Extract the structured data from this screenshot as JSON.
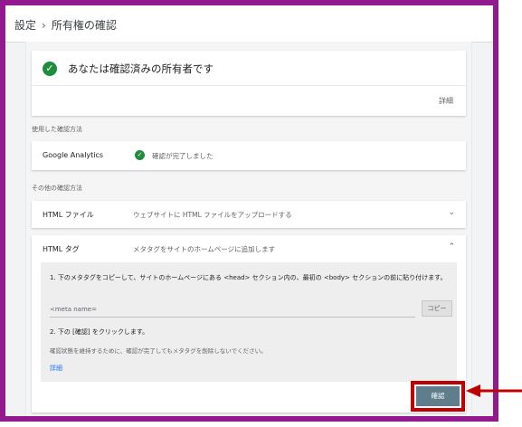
{
  "breadcrumb": {
    "parent": "設定",
    "separator": "›",
    "current": "所有権の確認"
  },
  "verified_card": {
    "title": "あなたは確認済みの所有者です",
    "details_link": "詳細"
  },
  "used_method": {
    "section_label": "使用した確認方法",
    "name": "Google Analytics",
    "status": "確認が完了しました"
  },
  "other_methods": {
    "section_label": "その他の確認方法",
    "html_file": {
      "name": "HTML ファイル",
      "description": "ウェブサイトに HTML ファイルをアップロードする"
    },
    "html_tag": {
      "name": "HTML タグ",
      "description": "メタタグをサイトのホームページに追加します",
      "step1": "1. 下のメタタグをコピーして、サイトのホームページにある <head> セクション内の、最初の <body> セクションの前に貼り付けます。",
      "meta_value": "<meta name=",
      "copy_label": "コピー",
      "step2": "2. 下の [確認] をクリックします。",
      "note": "確認状態を維持するために、確認が完了してもメタタグを削除しないでください。",
      "details_link": "詳細",
      "confirm_label": "確認"
    }
  },
  "colors": {
    "frame": "#93198f",
    "highlight": "#c00000",
    "check": "#1e8e3e",
    "confirm": "#607d8b",
    "link": "#1a73e8"
  },
  "icons": {
    "check": "check-circle-icon",
    "expand": "chevron-down-icon",
    "collapse": "chevron-up-icon",
    "pointer": "arrow-left-icon"
  }
}
